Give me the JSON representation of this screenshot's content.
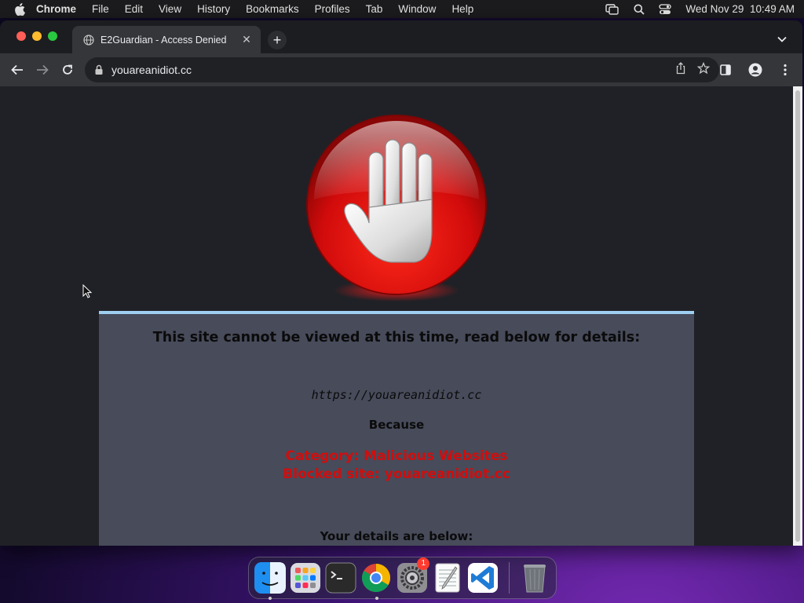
{
  "menubar": {
    "app_name": "Chrome",
    "items": [
      "File",
      "Edit",
      "View",
      "History",
      "Bookmarks",
      "Profiles",
      "Tab",
      "Window",
      "Help"
    ],
    "datetime": "Wed Nov 29  10:49 AM"
  },
  "browser": {
    "tab_title": "E2Guardian - Access Denied",
    "url": "youareanidiot.cc"
  },
  "page": {
    "heading": "This site cannot be viewed at this time, read below for details:",
    "blocked_url": "https://youareanidiot.cc",
    "because": "Because",
    "category": "Category: Malicious Websites",
    "blocked_site": "Blocked site: youareanidiot.cc",
    "details_heading": "Your details are below:",
    "colors": {
      "panel_bg": "#474b5a",
      "panel_border": "#9ecff0",
      "alert_red": "#d20d0d"
    }
  },
  "dock": {
    "apps": [
      "finder-icon",
      "launchpad-icon",
      "terminal-icon",
      "chrome-icon",
      "system-settings-icon",
      "textedit-icon",
      "vscode-icon",
      "trash-icon"
    ],
    "settings_badge": "1"
  }
}
